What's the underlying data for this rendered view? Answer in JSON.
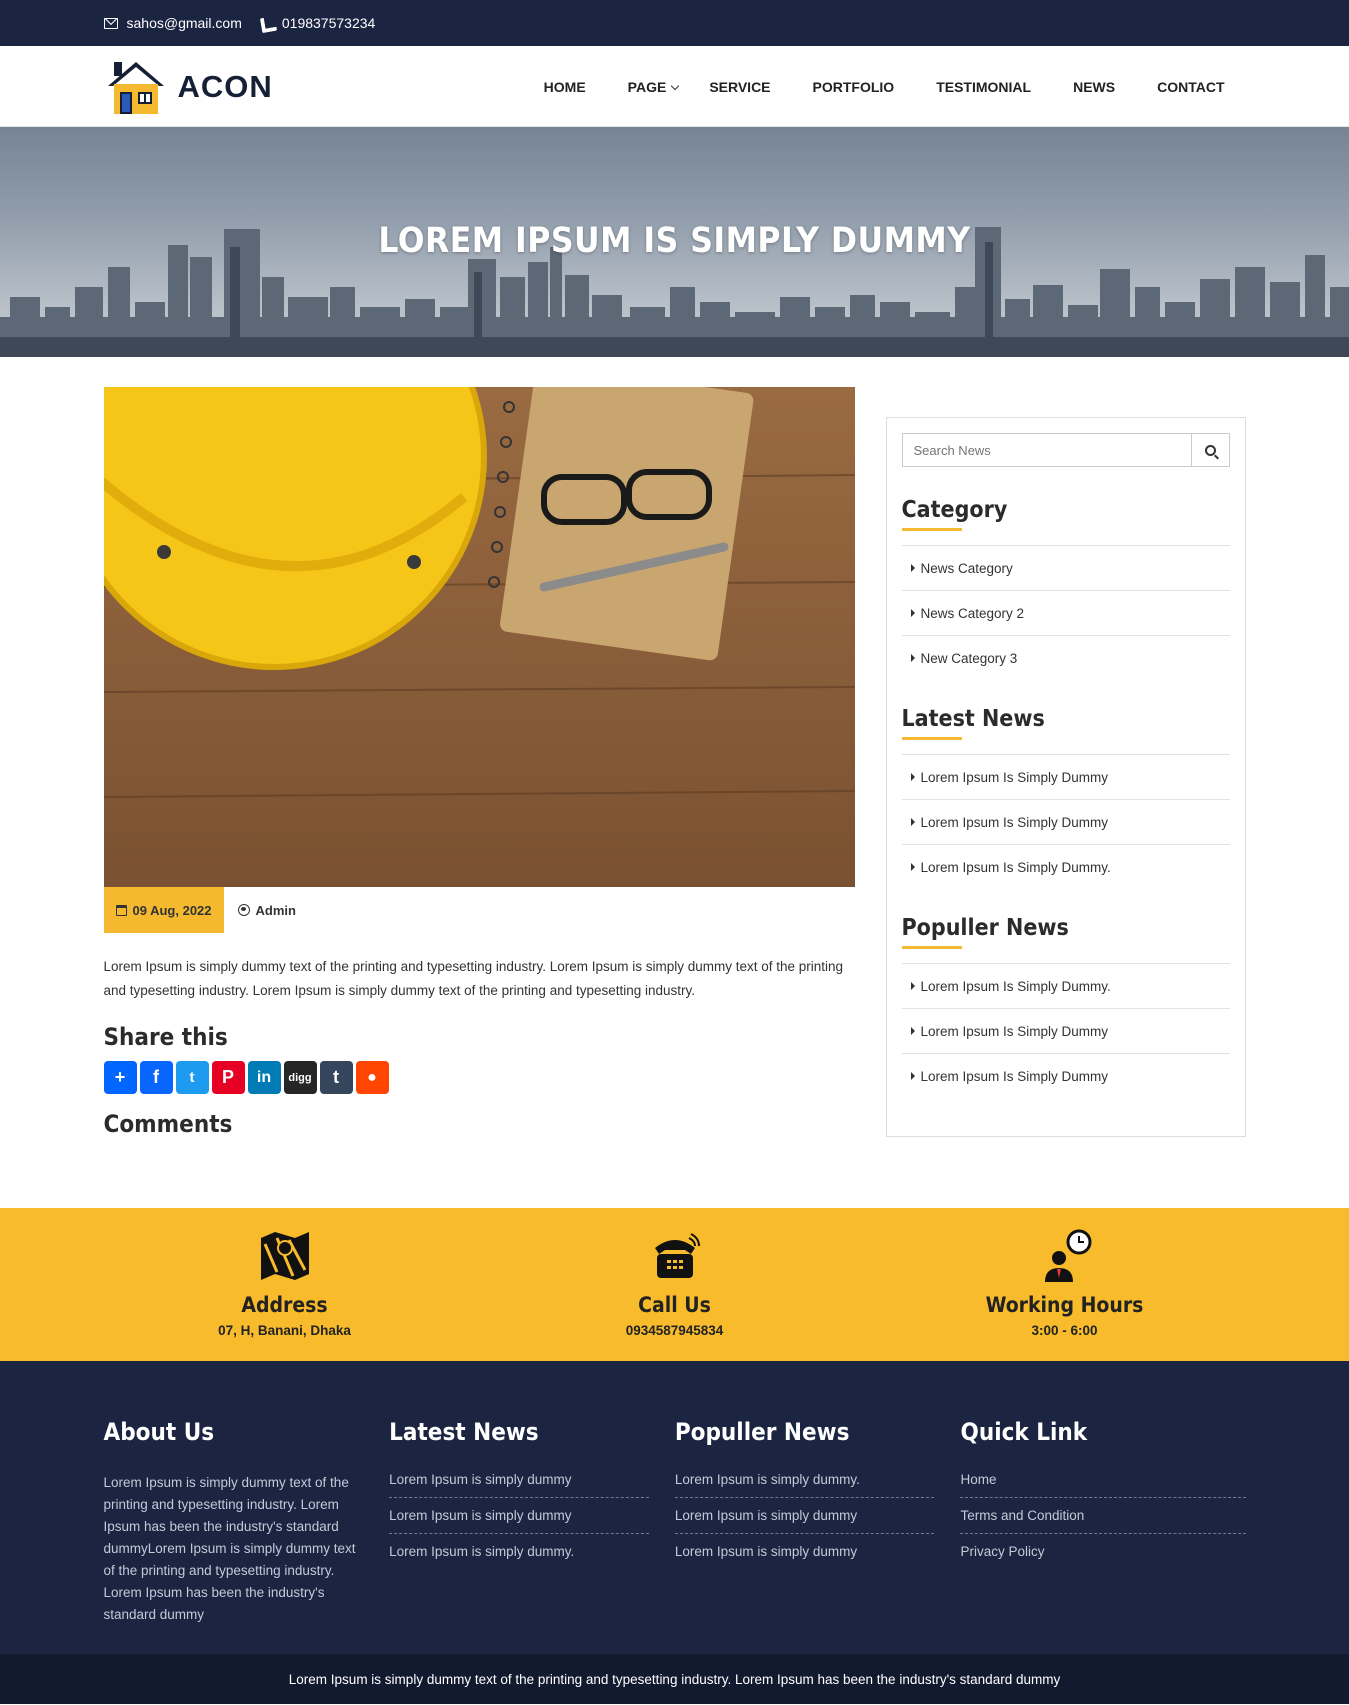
{
  "topbar": {
    "email": "sahos@gmail.com",
    "phone": "019837573234"
  },
  "brand": {
    "name": "ACON"
  },
  "nav": {
    "items": [
      "HOME",
      "PAGE",
      "SERVICE",
      "PORTFOLIO",
      "TESTIMONIAL",
      "NEWS",
      "CONTACT"
    ]
  },
  "hero": {
    "title": "LOREM IPSUM IS SIMPLY DUMMY"
  },
  "post": {
    "date": "09 Aug, 2022",
    "author": "Admin",
    "body": "Lorem Ipsum is simply dummy text of the printing and typesetting industry. Lorem Ipsum is simply dummy text of the printing and typesetting industry. Lorem Ipsum is simply dummy text of the printing and typesetting industry.",
    "share_title": "Share this",
    "comments_title": "Comments"
  },
  "share": {
    "icons": [
      "plus-icon",
      "facebook-icon",
      "twitter-icon",
      "pinterest-icon",
      "linkedin-icon",
      "digg-icon",
      "tumblr-icon",
      "reddit-icon"
    ],
    "colors": [
      "#0166ff",
      "#0866ff",
      "#1d9bf0",
      "#e60023",
      "#007bb5",
      "#262626",
      "#35465c",
      "#ff4500"
    ]
  },
  "sidebar": {
    "search_placeholder": "Search News",
    "category_title": "Category",
    "categories": [
      "News Category",
      "News Category 2",
      "New Category 3"
    ],
    "latest_title": "Latest News",
    "latest": [
      "Lorem Ipsum Is Simply Dummy",
      "Lorem Ipsum Is Simply Dummy",
      "Lorem Ipsum Is Simply Dummy."
    ],
    "popular_title": "Populler News",
    "popular": [
      "Lorem Ipsum Is Simply Dummy.",
      "Lorem Ipsum Is Simply Dummy",
      "Lorem Ipsum Is Simply Dummy"
    ]
  },
  "contact": {
    "address": {
      "title": "Address",
      "value": "07, H, Banani, Dhaka"
    },
    "call": {
      "title": "Call Us",
      "value": "0934587945834"
    },
    "hours": {
      "title": "Working Hours",
      "value": "3:00 - 6:00"
    }
  },
  "footer": {
    "about_title": "About Us",
    "about_text": "Lorem Ipsum is simply dummy text of the printing and typesetting industry. Lorem Ipsum has been the industry's standard dummyLorem Ipsum is simply dummy text of the printing and typesetting industry. Lorem Ipsum has been the industry's standard dummy",
    "latest_title": "Latest News",
    "latest": [
      "Lorem Ipsum is simply dummy",
      "Lorem Ipsum is simply dummy",
      "Lorem Ipsum is simply dummy."
    ],
    "popular_title": "Populler News",
    "popular": [
      "Lorem Ipsum is simply dummy.",
      "Lorem Ipsum is simply dummy",
      "Lorem Ipsum is simply dummy"
    ],
    "quick_title": "Quick Link",
    "quick": [
      "Home",
      "Terms and Condition",
      "Privacy Policy"
    ],
    "copyright": "Lorem Ipsum is simply dummy text of the printing and typesetting industry. Lorem Ipsum has been the industry's standard dummy"
  },
  "colors": {
    "navy": "#1b2542",
    "accent": "#f7bb2b"
  }
}
